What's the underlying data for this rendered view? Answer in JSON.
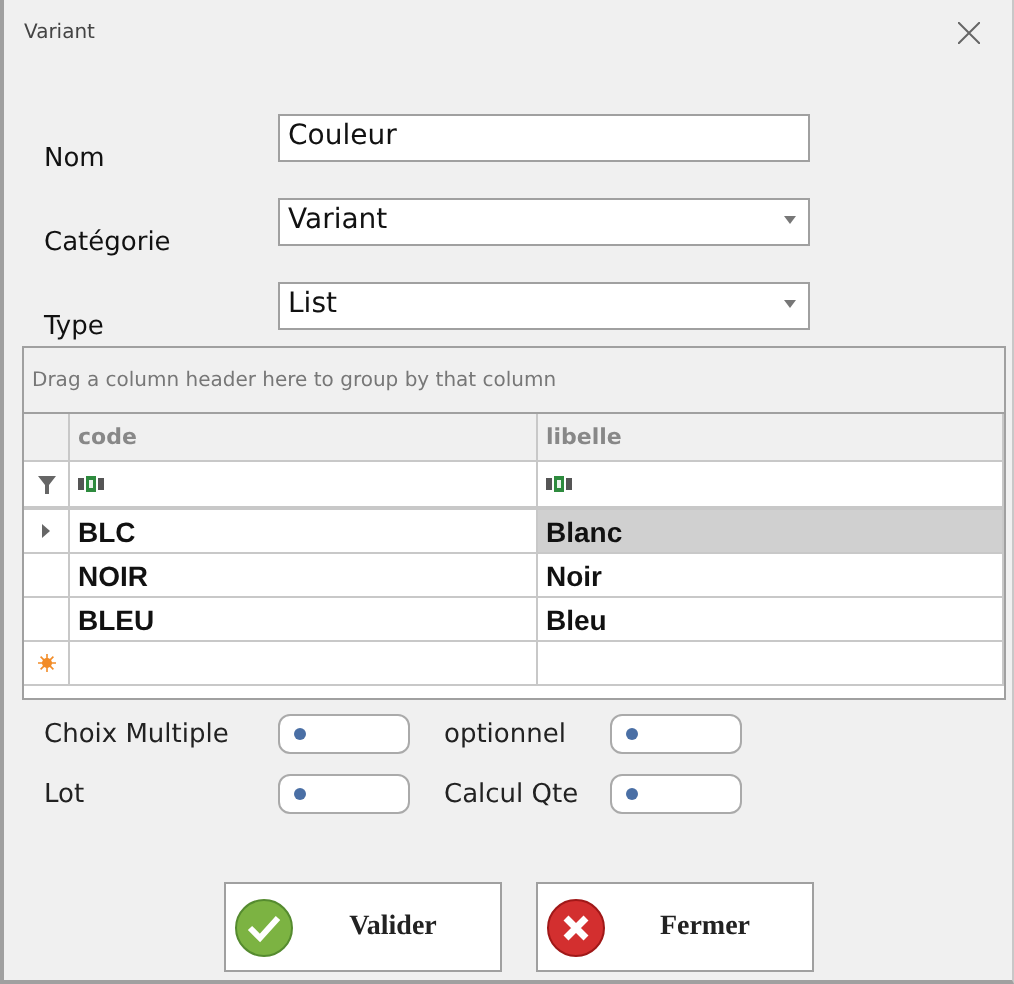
{
  "window": {
    "title": "Variant"
  },
  "fields": [
    {
      "label": "Nom",
      "value": "Couleur",
      "kind": "text"
    },
    {
      "label": "Catégorie",
      "value": "Variant",
      "kind": "combo"
    },
    {
      "label": "Type",
      "value": "List",
      "kind": "combo"
    }
  ],
  "grid": {
    "group_hint": "Drag a column header here to group by that column",
    "columns": [
      "code",
      "libelle"
    ],
    "rows": [
      {
        "cells": [
          "BLC",
          "Blanc"
        ],
        "selected": true
      },
      {
        "cells": [
          "NOIR",
          "Noir"
        ],
        "selected": false
      },
      {
        "cells": [
          "BLEU",
          "Bleu"
        ],
        "selected": false
      }
    ]
  },
  "toggles": [
    {
      "label": "Choix Multiple",
      "on": false
    },
    {
      "label": "optionnel",
      "on": false
    },
    {
      "label": "Lot",
      "on": false
    },
    {
      "label": "Calcul Qte",
      "on": false
    }
  ],
  "buttons": [
    {
      "label": "Valider",
      "kind": "ok"
    },
    {
      "label": "Fermer",
      "kind": "close"
    }
  ]
}
